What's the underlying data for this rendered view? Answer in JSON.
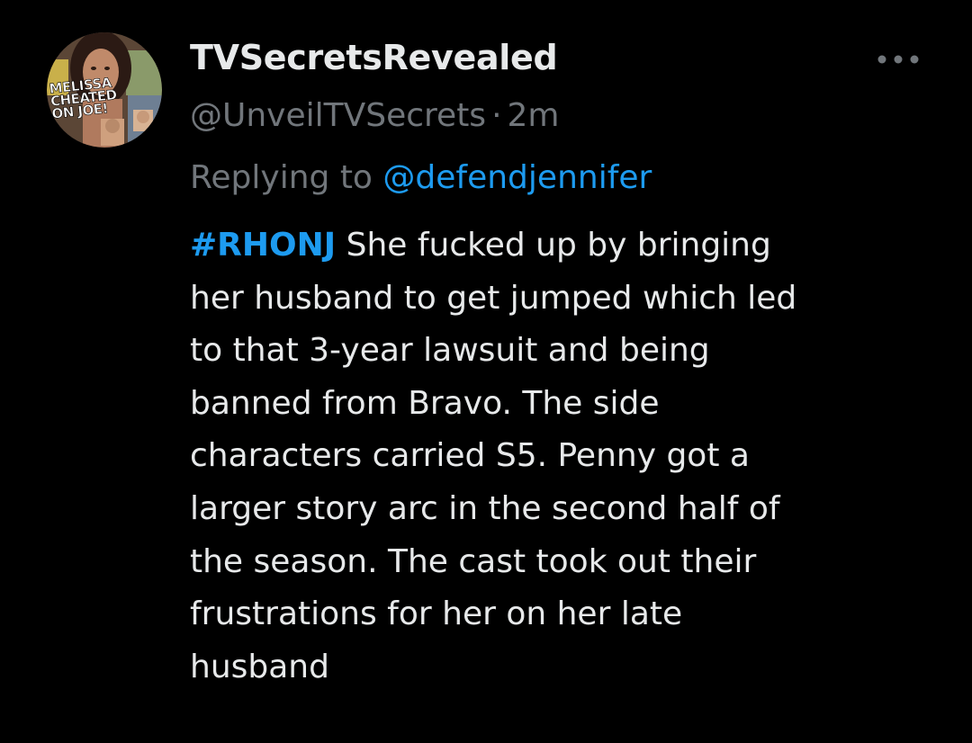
{
  "tweet": {
    "display_name": "TVSecretsRevealed",
    "handle": "@UnveilTVSecrets",
    "separator": "·",
    "time": "2m",
    "reply_prefix": "Replying to",
    "reply_mention": "@defendjennifer",
    "avatar_text": [
      "MELISSA",
      "CHEATED",
      "ON JOE!"
    ],
    "more_icon": "more-horizontal-icon",
    "hashtag": "#RHONJ",
    "body_lines": [
      "She fucked up by bringing",
      "her husband to get jumped which led",
      "to that 3-year lawsuit and being",
      "banned from Bravo. The side",
      "characters carried S5. Penny got a",
      "larger story arc in the second half of",
      "the season. The cast took out their",
      "frustrations for her on her late",
      "husband"
    ]
  },
  "colors": {
    "background": "#000000",
    "text_primary": "#e7e9ea",
    "text_secondary": "#71767b",
    "accent": "#1d9bf0"
  }
}
